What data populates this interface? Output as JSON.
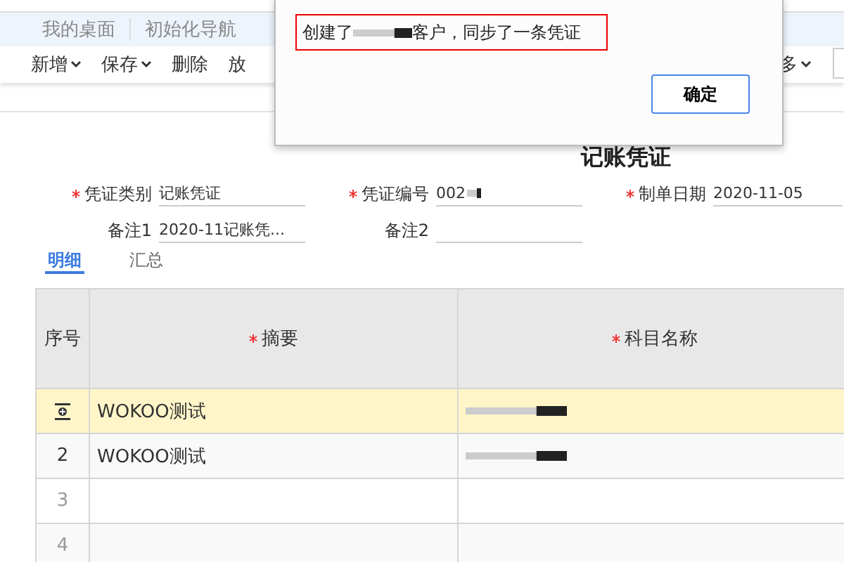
{
  "nav_tabs": [
    {
      "label": "我的桌面",
      "selected": false
    },
    {
      "label": "初始化导航",
      "selected": false
    }
  ],
  "toolbar": [
    {
      "label": "新增",
      "dropdown": true
    },
    {
      "label": "保存",
      "dropdown": true
    },
    {
      "label": "删除",
      "dropdown": false
    },
    {
      "label": "放",
      "dropdown": false
    }
  ],
  "toolbar_right": {
    "label": "多",
    "dropdown": true
  },
  "title": "记账凭证",
  "form": [
    {
      "label": "凭证类别",
      "required": true,
      "value": "记账凭证",
      "redacted": false
    },
    {
      "label": "凭证编号",
      "required": true,
      "value": "002",
      "redacted": true
    },
    {
      "label": "制单日期",
      "required": true,
      "value": "2020-11-05",
      "redacted": false
    },
    {
      "label": "备注1",
      "required": false,
      "value": "2020-11记账凭...",
      "redacted": false
    },
    {
      "label": "备注2",
      "required": false,
      "redacted": false
    }
  ],
  "detail_tabs": [
    {
      "label": "明细",
      "selected": true
    },
    {
      "label": "汇总",
      "selected": false
    }
  ],
  "table": {
    "columns": [
      {
        "label": "序号",
        "required": false
      },
      {
        "label": "摘要",
        "required": true
      },
      {
        "label": "科目名称",
        "required": true
      }
    ],
    "rows": [
      {
        "kind": "insert",
        "summary": "WOKOO测试",
        "subject_redacted": true,
        "selected": true
      },
      {
        "index": "2",
        "kind": "data",
        "summary": "WOKOO测试",
        "subject_redacted": true,
        "selected": false
      },
      {
        "index": "3",
        "kind": "empty",
        "subject_redacted": false,
        "selected": false
      },
      {
        "index": "4",
        "kind": "empty",
        "subject_redacted": false,
        "selected": false
      }
    ]
  },
  "dialog": {
    "message_before": "创建了",
    "message_after": "客户，同步了一条凭证",
    "button": "确定"
  }
}
